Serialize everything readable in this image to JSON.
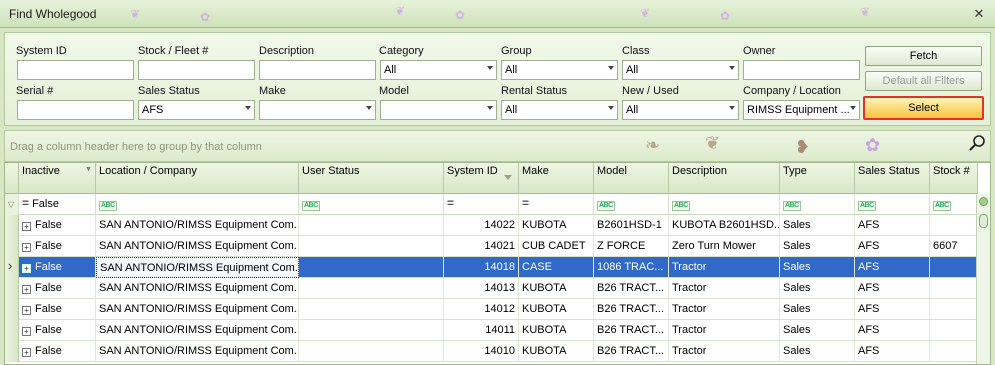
{
  "window": {
    "title": "Find Wholegood",
    "close_glyph": "✕"
  },
  "filters": {
    "system_id": {
      "label": "System ID",
      "value": ""
    },
    "stock_fleet": {
      "label": "Stock / Fleet #",
      "value": ""
    },
    "description": {
      "label": "Description",
      "value": ""
    },
    "category": {
      "label": "Category",
      "value": "All"
    },
    "group": {
      "label": "Group",
      "value": "All"
    },
    "class": {
      "label": "Class",
      "value": "All"
    },
    "owner": {
      "label": "Owner",
      "value": ""
    },
    "serial": {
      "label": "Serial #",
      "value": ""
    },
    "sales_status": {
      "label": "Sales Status",
      "value": "AFS"
    },
    "make": {
      "label": "Make",
      "value": ""
    },
    "model": {
      "label": "Model",
      "value": ""
    },
    "rental_status": {
      "label": "Rental Status",
      "value": "All"
    },
    "new_used": {
      "label": "New / Used",
      "value": "All"
    },
    "company_location": {
      "label": "Company / Location",
      "value": "RIMSS Equipment ..."
    }
  },
  "buttons": {
    "fetch": "Fetch",
    "default_filters": "Default all Filters",
    "select": "Select"
  },
  "group_panel": {
    "hint": "Drag a column header here to group by that column"
  },
  "grid": {
    "columns": [
      "Inactive",
      "Location / Company",
      "User Status",
      "System ID",
      "Make",
      "Model",
      "Description",
      "Type",
      "Sales Status",
      "Stock #"
    ],
    "filter_row": {
      "inactive": "False"
    },
    "rows": [
      [
        "False",
        "SAN ANTONIO/RIMSS Equipment Com...",
        "",
        "14022",
        "KUBOTA",
        "B2601HSD-1",
        "KUBOTA B2601HSD...",
        "Sales",
        "AFS",
        ""
      ],
      [
        "False",
        "SAN ANTONIO/RIMSS Equipment Com...",
        "",
        "14021",
        "CUB CADET",
        "Z FORCE",
        "Zero Turn Mower",
        "Sales",
        "AFS",
        "6607"
      ],
      [
        "False",
        "SAN ANTONIO/RIMSS Equipment Com...",
        "",
        "14018",
        "CASE",
        "1086 TRAC...",
        "Tractor",
        "Sales",
        "AFS",
        ""
      ],
      [
        "False",
        "SAN ANTONIO/RIMSS Equipment Com...",
        "",
        "14013",
        "KUBOTA",
        "B26 TRACT...",
        "Tractor",
        "Sales",
        "AFS",
        ""
      ],
      [
        "False",
        "SAN ANTONIO/RIMSS Equipment Com...",
        "",
        "14012",
        "KUBOTA",
        "B26 TRACT...",
        "Tractor",
        "Sales",
        "AFS",
        ""
      ],
      [
        "False",
        "SAN ANTONIO/RIMSS Equipment Com...",
        "",
        "14011",
        "KUBOTA",
        "B26 TRACT...",
        "Tractor",
        "Sales",
        "AFS",
        ""
      ],
      [
        "False",
        "SAN ANTONIO/RIMSS Equipment Com...",
        "",
        "14010",
        "KUBOTA",
        "B26 TRACT...",
        "Tractor",
        "Sales",
        "AFS",
        ""
      ]
    ],
    "selected_row": 2
  },
  "colors": {
    "selection": "#3069c8",
    "select_button_outline": "#e3322a",
    "theme_green": "#d7e7c4"
  }
}
